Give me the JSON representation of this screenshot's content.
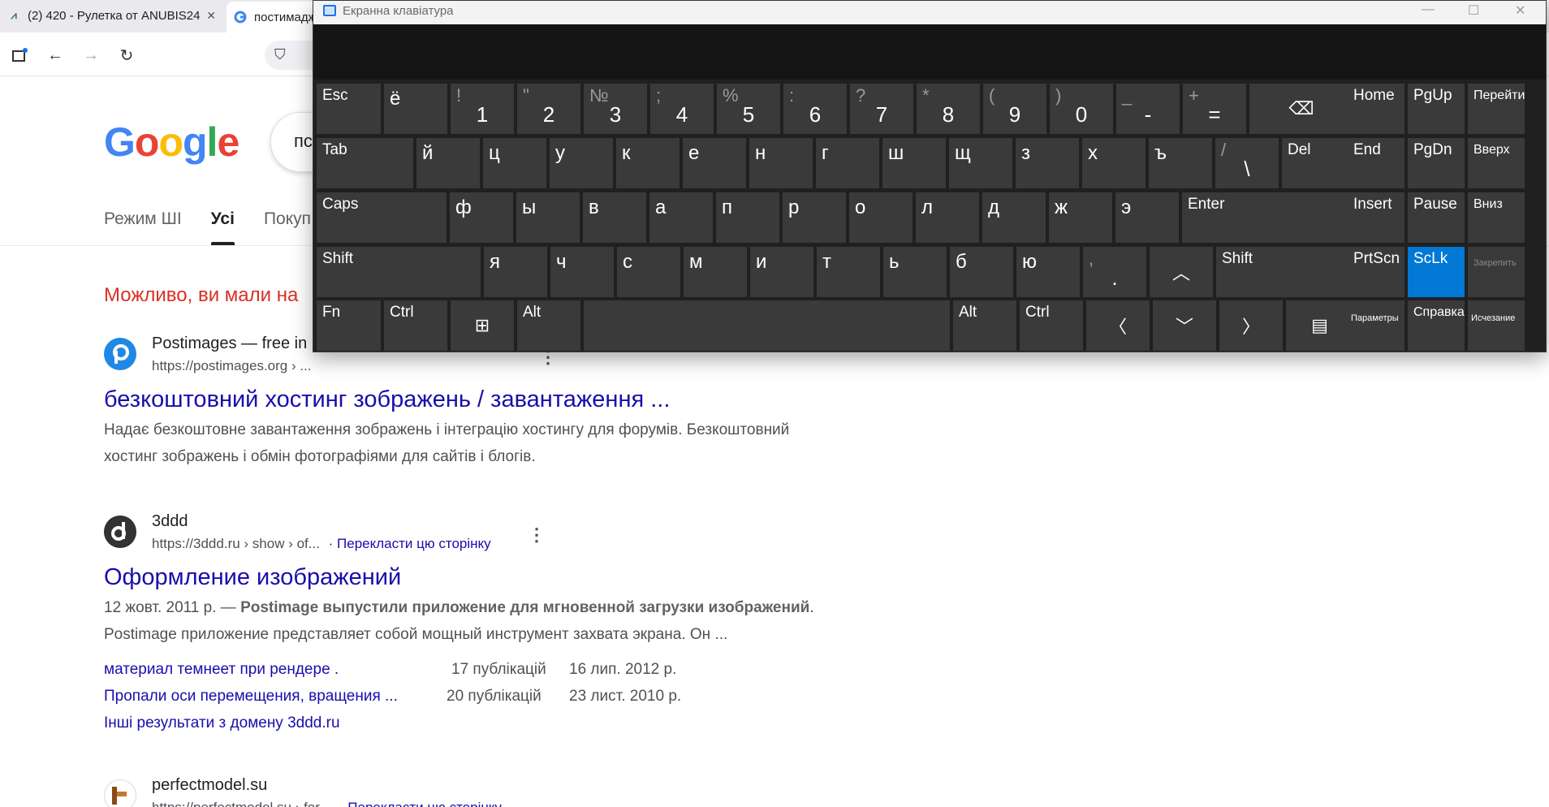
{
  "browser": {
    "tabs": [
      {
        "title": "(2) 420 - Рулетка от ANUBIS24",
        "icon": "chart-favicon-icon"
      },
      {
        "title": "постимадж",
        "icon": "google-favicon-icon"
      }
    ]
  },
  "google": {
    "logo": [
      "G",
      "o",
      "o",
      "g",
      "l",
      "e"
    ],
    "logo_colors": [
      "#4285F4",
      "#EA4335",
      "#FBBC05",
      "#4285F4",
      "#34A853",
      "#EA4335"
    ],
    "query": "пс",
    "tabs": [
      "Режим ШІ",
      "Усі",
      "Покуп"
    ],
    "spell_suggestion": "Можливо, ви мали на",
    "results": [
      {
        "site": "Postimages — free in",
        "url": "https://postimages.org › ...",
        "title": "безкоштовний хостинг зображень / завантаження ...",
        "snippet_lines": [
          "Надає безкоштовне завантаження зображень і інтеграцію хостингу для форумів. Безкоштовний",
          "хостинг зображень і обмін фотографіями для сайтів і блогів."
        ]
      },
      {
        "site": "3ddd",
        "url": "https://3ddd.ru › show › of...",
        "translate": "· Перекласти цю сторінку",
        "title": "Оформление изображений",
        "snippet_date": "12 жовт. 2011 р. — ",
        "snippet_bold": "Postimage выпустили приложение для мгновенной загрузки изображений",
        "snippet_tail": ".",
        "snippet_line2": "Postimage приложение представляет собой мощный инструмент захвата экрана. Он ...",
        "sublinks": [
          {
            "text": "материал темнеет при рендере .",
            "count": "17 публікацій",
            "date": "16 лип. 2012 р."
          },
          {
            "text": "Пропали оси перемещения, вращения ...",
            "count": "20 публікацій",
            "date": "23 лист. 2010 р."
          }
        ],
        "more": "Інші результати з домену 3ddd.ru"
      },
      {
        "site": "perfectmodel.su",
        "url": "https://perfectmodel.su › for...",
        "translate": "· Перекласти цю сторінку"
      }
    ]
  },
  "osk": {
    "title": "Екранна клавіатура",
    "active_color": "#0078d4",
    "rows": [
      [
        {
          "label": "Esc"
        },
        {
          "label": "ё",
          "big": true
        },
        {
          "shift": "!",
          "main": "1"
        },
        {
          "shift": "\"",
          "main": "2"
        },
        {
          "shift": "№",
          "main": "3"
        },
        {
          "shift": ";",
          "main": "4"
        },
        {
          "shift": "%",
          "main": "5"
        },
        {
          "shift": ":",
          "main": "6"
        },
        {
          "shift": "?",
          "main": "7"
        },
        {
          "shift": "*",
          "main": "8"
        },
        {
          "shift": "(",
          "main": "9"
        },
        {
          "shift": ")",
          "main": "0"
        },
        {
          "shift": "_",
          "main": "-"
        },
        {
          "shift": "+",
          "main": "="
        },
        {
          "glyph": "⌫",
          "name": "backspace-key"
        }
      ],
      [
        {
          "label": "Tab"
        },
        {
          "label": "й",
          "big": true
        },
        {
          "label": "ц",
          "big": true
        },
        {
          "label": "у",
          "big": true
        },
        {
          "label": "к",
          "big": true
        },
        {
          "label": "е",
          "big": true
        },
        {
          "label": "н",
          "big": true
        },
        {
          "label": "г",
          "big": true
        },
        {
          "label": "ш",
          "big": true
        },
        {
          "label": "щ",
          "big": true
        },
        {
          "label": "з",
          "big": true
        },
        {
          "label": "х",
          "big": true
        },
        {
          "label": "ъ",
          "big": true
        },
        {
          "shift": "/",
          "main": "\\"
        },
        {
          "label": "Del"
        }
      ],
      [
        {
          "label": "Caps"
        },
        {
          "label": "ф",
          "big": true
        },
        {
          "label": "ы",
          "big": true
        },
        {
          "label": "в",
          "big": true
        },
        {
          "label": "а",
          "big": true
        },
        {
          "label": "п",
          "big": true
        },
        {
          "label": "р",
          "big": true
        },
        {
          "label": "о",
          "big": true
        },
        {
          "label": "л",
          "big": true
        },
        {
          "label": "д",
          "big": true
        },
        {
          "label": "ж",
          "big": true
        },
        {
          "label": "э",
          "big": true
        },
        {
          "label": "Enter"
        }
      ],
      [
        {
          "label": "Shift"
        },
        {
          "label": "я",
          "big": true
        },
        {
          "label": "ч",
          "big": true
        },
        {
          "label": "с",
          "big": true
        },
        {
          "label": "м",
          "big": true
        },
        {
          "label": "и",
          "big": true
        },
        {
          "label": "т",
          "big": true
        },
        {
          "label": "ь",
          "big": true
        },
        {
          "label": "б",
          "big": true
        },
        {
          "label": "ю",
          "big": true
        },
        {
          "shift": ",",
          "main": "."
        },
        {
          "glyph": "︿",
          "name": "arrow-up-key"
        },
        {
          "label": "Shift"
        }
      ],
      [
        {
          "label": "Fn"
        },
        {
          "label": "Ctrl"
        },
        {
          "glyph": "⊞",
          "name": "windows-key"
        },
        {
          "label": "Alt"
        },
        {
          "label": "",
          "name": "space-key"
        },
        {
          "label": "Alt"
        },
        {
          "label": "Ctrl"
        },
        {
          "glyph": "〈",
          "name": "arrow-left-key"
        },
        {
          "glyph": "﹀",
          "name": "arrow-down-key"
        },
        {
          "glyph": "〉",
          "name": "arrow-right-key"
        },
        {
          "glyph": "▤",
          "name": "menu-key"
        }
      ]
    ],
    "nav": [
      [
        {
          "label": "Home"
        },
        {
          "label": "PgUp"
        },
        {
          "label": "Перейти",
          "small": true
        }
      ],
      [
        {
          "label": "End"
        },
        {
          "label": "PgDn"
        },
        {
          "label": "Вверх",
          "small": true
        }
      ],
      [
        {
          "label": "Insert"
        },
        {
          "label": "Pause"
        },
        {
          "label": "Вниз",
          "small": true
        }
      ],
      [
        {
          "label": "PrtScn"
        },
        {
          "label": "ScLk",
          "active": true
        },
        {
          "label": "Закрепить",
          "xs": true
        }
      ],
      [
        {
          "label": "Параметры",
          "tiny": true
        },
        {
          "label": "Справка",
          "small": true
        },
        {
          "label": "Исчезание",
          "tiny": true
        }
      ]
    ]
  }
}
